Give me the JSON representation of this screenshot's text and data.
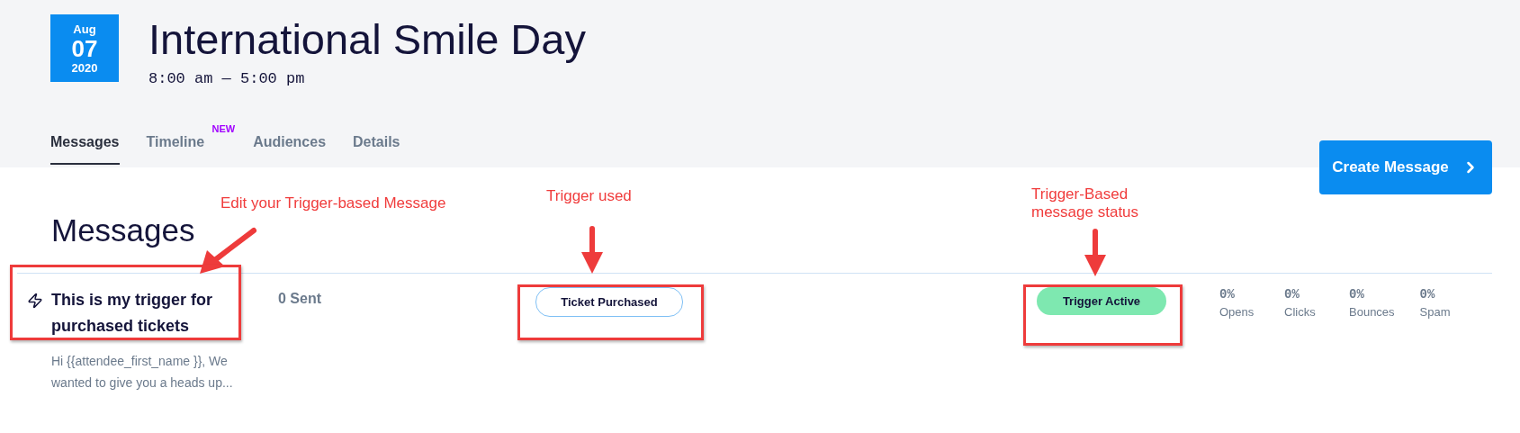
{
  "event": {
    "date": {
      "month": "Aug",
      "day": "07",
      "year": "2020"
    },
    "title": "International Smile Day",
    "time": "8:00 am — 5:00 pm"
  },
  "tabs": [
    {
      "label": "Messages",
      "selected": true
    },
    {
      "label": "Timeline",
      "selected": false,
      "badge": "NEW"
    },
    {
      "label": "Audiences",
      "selected": false
    },
    {
      "label": "Details",
      "selected": false
    }
  ],
  "create_button": "Create Message",
  "section_title": "Messages",
  "messages": [
    {
      "title": "This is my trigger for purchased tickets",
      "preview": "Hi {{attendee_first_name }}, We wanted to give you a heads up...",
      "sent": "0 Sent",
      "trigger": "Ticket Purchased",
      "status": {
        "label": "Trigger Active",
        "active": true
      },
      "stats": [
        {
          "value": "0%",
          "label": "Opens"
        },
        {
          "value": "0%",
          "label": "Clicks"
        },
        {
          "value": "0%",
          "label": "Bounces"
        },
        {
          "value": "0%",
          "label": "Spam"
        }
      ]
    }
  ],
  "annotations": [
    {
      "text": "Edit your Trigger-based Message",
      "kind": "diagonal"
    },
    {
      "text": "Trigger used",
      "kind": "down"
    },
    {
      "text": "Trigger-Based message status",
      "kind": "down"
    }
  ]
}
